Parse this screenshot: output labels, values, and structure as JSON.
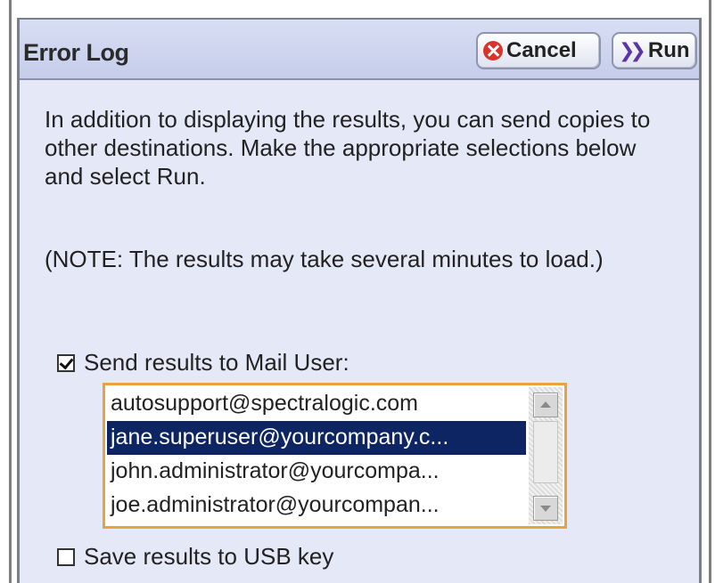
{
  "dialog": {
    "title": "Error Log",
    "cancel_label": "Cancel",
    "run_label": "Run",
    "cancel_icon": "cancel-x-circle-icon",
    "run_icon": "double-chevron-right-icon"
  },
  "content": {
    "intro": "In addition to displaying the results, you can send copies to other destinations. Make the appropriate selections below and select Run.",
    "note": "(NOTE: The results may take several minutes to load.)"
  },
  "mail": {
    "label": "Send results to Mail User:",
    "checked": true,
    "recipients": [
      {
        "address": "autosupport@spectralogic.com",
        "selected": false
      },
      {
        "address": "jane.superuser@yourcompany.c...",
        "selected": true
      },
      {
        "address": "john.administrator@yourcompa...",
        "selected": false
      },
      {
        "address": "joe.administrator@yourcompan...",
        "selected": false
      }
    ]
  },
  "usb": {
    "label": "Save results to USB key",
    "checked": false
  },
  "colors": {
    "title_bar": "#c6cdea",
    "panel_background": "#e5e9f7",
    "selection": "#0e2563",
    "listbox_focus_border": "#e7a33c",
    "cancel_icon": "#d9342b",
    "run_icon": "#5b35a6"
  }
}
